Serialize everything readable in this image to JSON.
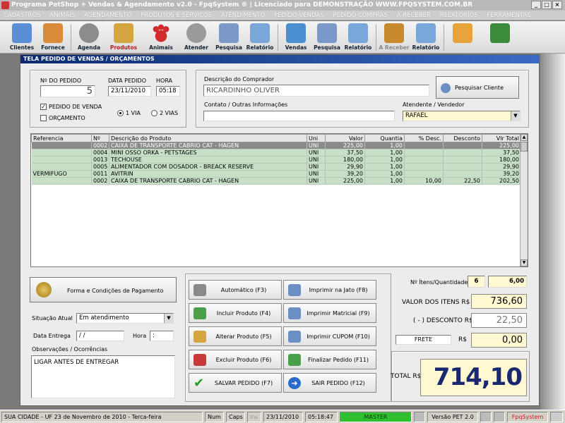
{
  "window": {
    "title": "Programa PetShop + Vendas & Agendamento v2.0 - FpqSystem ® | Licenciado para  DEMONSTRAÇÃO WWW.FPQSYSTEM.COM.BR"
  },
  "menu": [
    "CADASTROS",
    "ANIMAIS",
    "AGENDAMENTO",
    "PRODUTOS E SERVIÇOS",
    "ATENDIMENTO",
    "PEDIDO VENDAS",
    "PEDIDO COMPRAS",
    "A RECEBER",
    "RELATÓRIOS",
    "FERRAMENTAS"
  ],
  "toolbar": [
    {
      "label": "Clientes",
      "icon": "clients-icon",
      "color": "#5a8fd6"
    },
    {
      "label": "Fornece",
      "icon": "suppliers-icon",
      "color": "#d98b3a"
    },
    {
      "label": "Agenda",
      "icon": "schedule-icon",
      "color": "#8c8c8c"
    },
    {
      "label": "Produtos",
      "icon": "products-icon",
      "color": "#d4a640"
    },
    {
      "label": "Animais",
      "icon": "paw-icon",
      "color": "#d12b2b"
    },
    {
      "label": "Atender",
      "icon": "attend-icon",
      "color": "#9a9a9a"
    },
    {
      "label": "Pesquisa",
      "icon": "search-icon",
      "color": "#7a98c8"
    },
    {
      "label": "Relatório",
      "icon": "report-icon",
      "color": "#7aa7d9"
    },
    {
      "label": "Vendas",
      "icon": "sales-icon",
      "color": "#4a8fd0"
    },
    {
      "label": "Pesquisa",
      "icon": "search-icon",
      "color": "#7a98c8"
    },
    {
      "label": "Relatório",
      "icon": "report-icon",
      "color": "#7aa7d9"
    },
    {
      "label": "A Receber",
      "icon": "receivable-icon",
      "color": "#c98a2e"
    },
    {
      "label": "Relatório",
      "icon": "report-icon",
      "color": "#7aa7d9"
    },
    {
      "label": "",
      "icon": "calculator-icon",
      "color": "#e6a43a"
    },
    {
      "label": "",
      "icon": "exit-icon",
      "color": "#3c8a3c"
    }
  ],
  "form": {
    "title": "TELA PEDIDO DE VENDAS / ORÇAMENTOS",
    "order_no_label": "Nº DO PEDIDO",
    "order_no": "5",
    "date_label": "DATA PEDIDO",
    "date": "23/11/2010",
    "time_label": "HORA",
    "time": "05:18",
    "chk_pedido": "PEDIDO DE VENDA",
    "chk_orcamento": "ORÇAMENTO",
    "radio_1via": "1 VIA",
    "radio_2vias": "2 VIAS",
    "buyer_label": "Descrição do Comprador",
    "buyer": "RICARDINHO OLIVER",
    "search_client": "Pesquisar Cliente",
    "contact_label": "Contato / Outras Informações",
    "contact": "",
    "attendant_label": "Atendente / Vendedor",
    "attendant": "RAFAEL"
  },
  "grid": {
    "headers": [
      "Referencia",
      "Nº",
      "Descrição do Produto",
      "Uni",
      "Valor",
      "Quantia",
      "% Desc.",
      "Desconto",
      "Vlr Total"
    ],
    "rows": [
      [
        "",
        "0002",
        "CAIXA DE TRANSPORTE CABRIO CAT - HAGEN",
        "UNI",
        "225,00",
        "1,00",
        "",
        "",
        "225,00"
      ],
      [
        "",
        "0004",
        "MINI OSSO ORKA - PETSTAGES",
        "UNI",
        "37,50",
        "1,00",
        "",
        "",
        "37,50"
      ],
      [
        "",
        "0013",
        "TECHOUSE",
        "UNI",
        "180,00",
        "1,00",
        "",
        "",
        "180,00"
      ],
      [
        "",
        "0005",
        "ALIMENTADOR COM DOSADOR - BREACK RESERVE",
        "UNI",
        "29,90",
        "1,00",
        "",
        "",
        "29,90"
      ],
      [
        "VERMIFUGO",
        "0011",
        "AVITRIN",
        "UNI",
        "39,20",
        "1,00",
        "",
        "",
        "39,20"
      ],
      [
        "",
        "0002",
        "CAIXA DE TRANSPORTE CABRIO CAT - HAGEN",
        "UNI",
        "225,00",
        "1,00",
        "10,00",
        "22,50",
        "202,50"
      ]
    ]
  },
  "payment_button": "Forma e Condições de Pagamento",
  "status_label": "Situação Atual",
  "status_value": "Em atendimento",
  "delivery_label": "Data  Entrega",
  "delivery_date": "  /  /",
  "delivery_hour_label": "Hora",
  "delivery_hour": "  :",
  "obs_label": "Observações / Ocorrências",
  "obs": "LIGAR ANTES DE ENTREGAR",
  "actions": [
    {
      "label": "Automático   (F3)",
      "icon": "auto-icon",
      "color": "#8a8a8a"
    },
    {
      "label": "Imprimir na Jato  (F8)",
      "icon": "printer-icon",
      "color": "#6b8fc4"
    },
    {
      "label": "Incluir Produto  (F4)",
      "icon": "add-product-icon",
      "color": "#4aa04a"
    },
    {
      "label": "Imprimir Matricial  (F9)",
      "icon": "printer-icon",
      "color": "#6b8fc4"
    },
    {
      "label": "Alterar Produto  (F5)",
      "icon": "edit-product-icon",
      "color": "#d4a640"
    },
    {
      "label": "Imprimir CUPOM  (F10)",
      "icon": "printer-icon",
      "color": "#6b8fc4"
    },
    {
      "label": "Excluir Produto  (F6)",
      "icon": "delete-product-icon",
      "color": "#c83a3a"
    },
    {
      "label": "Finalizar Pedido  (F11)",
      "icon": "finalize-icon",
      "color": "#4aa04a"
    },
    {
      "label": "SALVAR PEDIDO (F7)",
      "icon": "checkmark-icon",
      "color": "#2a9a2a"
    },
    {
      "label": "SAIR  PEDIDO  (F12)",
      "icon": "exit-arrow-icon",
      "color": "#2a6ac8"
    }
  ],
  "totals": {
    "items_label": "Nº Ítens/Quantidade",
    "items": "6",
    "quantity": "6,00",
    "value_label": "VALOR DOS ITENS R$",
    "value": "736,60",
    "discount_label": "( - ) DESCONTO R$",
    "discount": "22,50",
    "freight_label": "FRETE",
    "freight_currency": "R$",
    "freight": "0,00",
    "total_label": "TOTAL R$",
    "total": "714,10"
  },
  "statusbar": {
    "city": "SUA CIDADE - UF 23 de Novembro de 2010 - Terca-feira",
    "num": "Num",
    "caps": "Caps",
    "ins": "Ins",
    "date": "23/11/2010",
    "time": "05:18:47",
    "user": "MASTER",
    "version": "Versão PET 2.0",
    "brand": "FpqSystem"
  }
}
